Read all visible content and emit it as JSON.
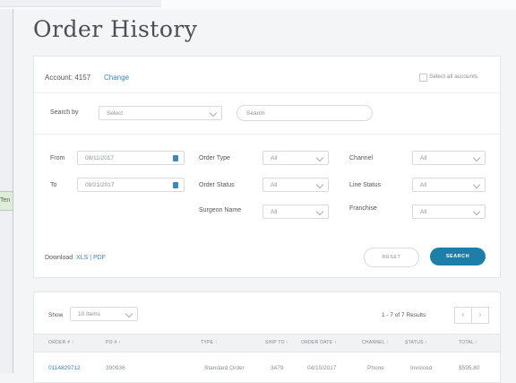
{
  "page": {
    "title": "Order History"
  },
  "left_tab": "Ten",
  "account": {
    "label": "Account: 4157",
    "change": "Change",
    "select_all": "Select all accounts"
  },
  "search": {
    "by_label": "Search by",
    "by_value": "Select",
    "placeholder": "Search"
  },
  "filters": {
    "from_label": "From",
    "from_value": "09/11/2017",
    "to_label": "To",
    "to_value": "09/21/2017",
    "order_type_label": "Order Type",
    "order_type_value": "All",
    "order_status_label": "Order Status",
    "order_status_value": "All",
    "surgeon_label": "Surgeon Name",
    "surgeon_value": "All",
    "channel_label": "Channel",
    "channel_value": "All",
    "line_status_label": "Line Status",
    "line_status_value": "All",
    "franchise_label": "Franchise",
    "franchise_value": "All"
  },
  "download": {
    "label": "Download",
    "xls": "XLS",
    "sep": "|",
    "pdf": "PDF"
  },
  "actions": {
    "reset": "RESET",
    "search": "SEARCH"
  },
  "results": {
    "show_label": "Show",
    "show_value": "10 Items",
    "pager": "1 - 7 of 7 Results",
    "prev": "‹",
    "next": "›",
    "columns": [
      "ORDER # ↑",
      "PO # ↑",
      "TYPE ↑",
      "SHIP TO ↑",
      "ORDER DATE ↑",
      "CHANNEL ↑",
      "STATUS ↑",
      "TOTAL ↑"
    ],
    "rows": [
      [
        "0114829712",
        "390936",
        "Standard Order",
        "3479",
        "04/10/2017",
        "Phone",
        "Invoiced",
        "$595.80"
      ]
    ]
  },
  "colors": {
    "accent": "#3a86c3",
    "primary_button": "#1d7fa8"
  }
}
